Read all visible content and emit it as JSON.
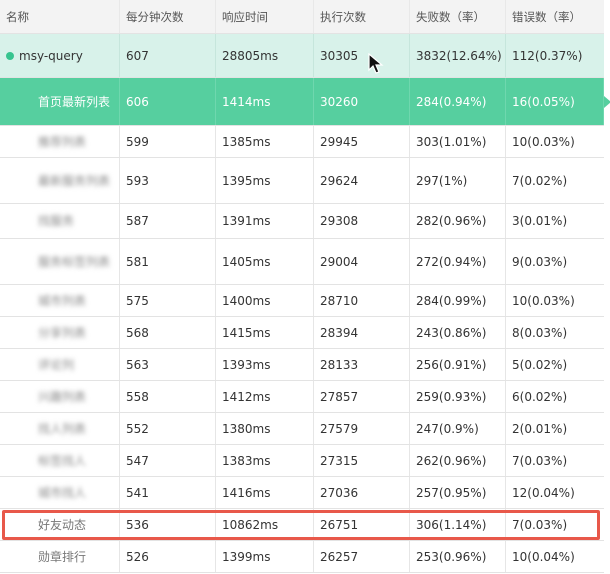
{
  "columns": [
    "名称",
    "每分钟次数",
    "响应时间",
    "执行次数",
    "失败数（率）",
    "错误数（率）"
  ],
  "group": {
    "name": "msy-query",
    "per_minute": "607",
    "response_time": "28805ms",
    "executions": "30305",
    "failures": "3832(12.64%)",
    "errors": "112(0.37%)"
  },
  "rows": [
    {
      "name": "首页最新列表",
      "per_minute": "606",
      "response_time": "1414ms",
      "executions": "30260",
      "failures": "284(0.94%)",
      "errors": "16(0.05%)"
    },
    {
      "name": "推荐列表",
      "per_minute": "599",
      "response_time": "1385ms",
      "executions": "29945",
      "failures": "303(1.01%)",
      "errors": "10(0.03%)"
    },
    {
      "name": "最新服务列表",
      "per_minute": "593",
      "response_time": "1395ms",
      "executions": "29624",
      "failures": "297(1%)",
      "errors": "7(0.02%)"
    },
    {
      "name": "找服务",
      "per_minute": "587",
      "response_time": "1391ms",
      "executions": "29308",
      "failures": "282(0.96%)",
      "errors": "3(0.01%)"
    },
    {
      "name": "服务标签列表",
      "per_minute": "581",
      "response_time": "1405ms",
      "executions": "29004",
      "failures": "272(0.94%)",
      "errors": "9(0.03%)"
    },
    {
      "name": "城市列表",
      "per_minute": "575",
      "response_time": "1400ms",
      "executions": "28710",
      "failures": "284(0.99%)",
      "errors": "10(0.03%)"
    },
    {
      "name": "分享列表",
      "per_minute": "568",
      "response_time": "1415ms",
      "executions": "28394",
      "failures": "243(0.86%)",
      "errors": "8(0.03%)"
    },
    {
      "name": "评论列",
      "per_minute": "563",
      "response_time": "1393ms",
      "executions": "28133",
      "failures": "256(0.91%)",
      "errors": "5(0.02%)"
    },
    {
      "name": "兴趣列表",
      "per_minute": "558",
      "response_time": "1412ms",
      "executions": "27857",
      "failures": "259(0.93%)",
      "errors": "6(0.02%)"
    },
    {
      "name": "找人列表",
      "per_minute": "552",
      "response_time": "1380ms",
      "executions": "27579",
      "failures": "247(0.9%)",
      "errors": "2(0.01%)"
    },
    {
      "name": "标签找人",
      "per_minute": "547",
      "response_time": "1383ms",
      "executions": "27315",
      "failures": "262(0.96%)",
      "errors": "7(0.03%)"
    },
    {
      "name": "城市找人",
      "per_minute": "541",
      "response_time": "1416ms",
      "executions": "27036",
      "failures": "257(0.95%)",
      "errors": "12(0.04%)"
    },
    {
      "name": "好友动态",
      "per_minute": "536",
      "response_time": "10862ms",
      "executions": "26751",
      "failures": "306(1.14%)",
      "errors": "7(0.03%)"
    },
    {
      "name": "勋章排行",
      "per_minute": "526",
      "response_time": "1399ms",
      "executions": "26257",
      "failures": "253(0.96%)",
      "errors": "10(0.04%)"
    }
  ],
  "colors": {
    "accent": "#56cf9f",
    "group_bg": "#d8f2ea",
    "status_dot": "#37c48f",
    "highlight": "#e8584a"
  }
}
